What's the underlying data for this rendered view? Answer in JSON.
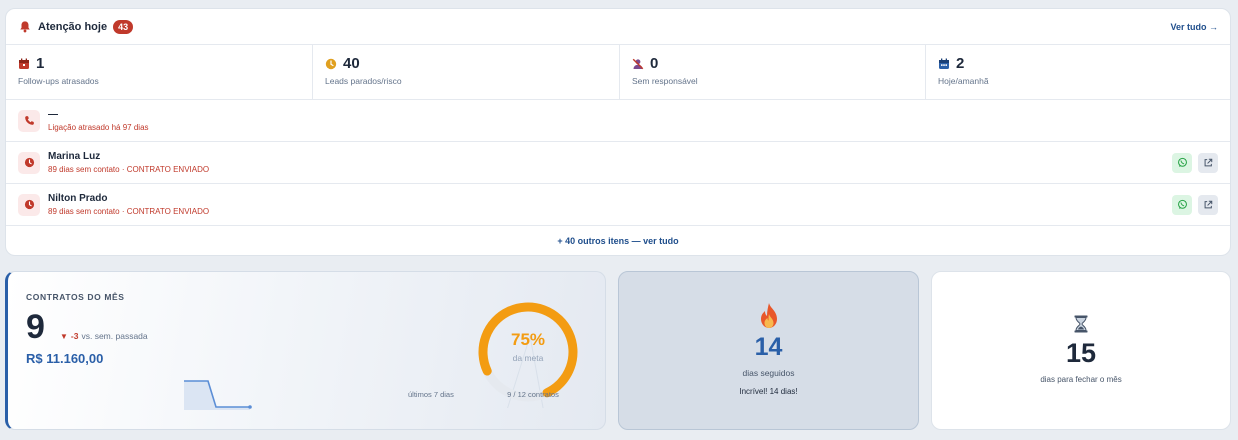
{
  "attention": {
    "title": "Atenção hoje",
    "badge": "43",
    "see_all": "Ver tudo →",
    "stats": [
      {
        "icon": "calendar-overdue-icon",
        "value": "1",
        "label": "Follow-ups atrasados"
      },
      {
        "icon": "clock-warning-icon",
        "value": "40",
        "label": "Leads parados/risco"
      },
      {
        "icon": "user-off-icon",
        "value": "0",
        "label": "Sem responsável"
      },
      {
        "icon": "calendar-today-icon",
        "value": "2",
        "label": "Hoje/amanhã"
      }
    ],
    "items": [
      {
        "icon": "phone-icon",
        "name": "—",
        "subtitle": "Ligação atrasado há 97 dias",
        "actions": false
      },
      {
        "icon": "clock-icon",
        "name": "Marina Luz",
        "subtitle": "89 dias sem contato · CONTRATO ENVIADO",
        "actions": true
      },
      {
        "icon": "clock-icon",
        "name": "Nilton Prado",
        "subtitle": "89 dias sem contato · CONTRATO ENVIADO",
        "actions": true
      }
    ],
    "more": "+ 40 outros itens — ver tudo"
  },
  "contracts": {
    "title": "CONTRATOS DO MÊS",
    "count": "9",
    "delta": "-3",
    "delta_label": "vs. sem. passada",
    "revenue": "R$ 11.160,00",
    "sparkline_label": "últimos 7 dias",
    "goal_percent": "75%",
    "goal_fraction": 0.75,
    "goal_label": "da meta",
    "goal_count": "9 / 12 contratos"
  },
  "streak": {
    "value": "14",
    "label": "dias seguidos",
    "message": "Incrível! 14 dias!"
  },
  "days_left": {
    "value": "15",
    "label": "dias para fechar o mês"
  },
  "colors": {
    "accent_blue": "#2a5fa8",
    "danger_red": "#c0392b",
    "gauge_orange": "#f39c12",
    "whatsapp_green": "#25a244"
  }
}
